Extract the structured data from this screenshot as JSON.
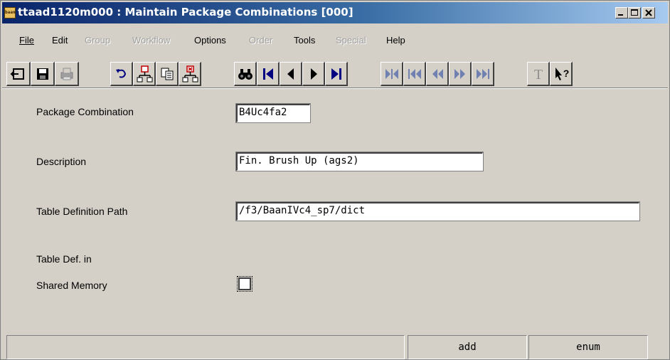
{
  "window": {
    "title": "ttaad1120m000 : Maintain Package Combinations [000]",
    "app_icon_text": "baan"
  },
  "menu": [
    {
      "label": "File",
      "enabled": true
    },
    {
      "label": "Edit",
      "enabled": true
    },
    {
      "label": "Group",
      "enabled": false
    },
    {
      "label": "Workflow",
      "enabled": false
    },
    {
      "label": "Options",
      "enabled": true
    },
    {
      "label": "Order",
      "enabled": false
    },
    {
      "label": "Tools",
      "enabled": true
    },
    {
      "label": "Special",
      "enabled": false
    },
    {
      "label": "Help",
      "enabled": true
    }
  ],
  "toolbar": {
    "icons": [
      "exit-icon",
      "save-icon",
      "print-icon",
      "undo-icon",
      "insert-record-icon",
      "copy-icon",
      "delete-record-icon",
      "find-icon",
      "first-record-icon",
      "previous-record-icon",
      "next-record-icon",
      "last-record-icon",
      "first-set-icon",
      "previous-set-icon",
      "previous-group-icon",
      "next-group-icon",
      "last-set-icon",
      "text-icon",
      "help-icon"
    ],
    "text_button_label": "T",
    "help_button_label": "?"
  },
  "form": {
    "package_combination": {
      "label": "Package Combination",
      "value": "B4Uc4fa2"
    },
    "description": {
      "label": "Description",
      "value": "Fin. Brush Up (ags2)"
    },
    "table_definition_path": {
      "label": "Table Definition Path",
      "value": "/f3/BaanIVc4_sp7/dict"
    },
    "shared_memory": {
      "label_line1": "Table Def. in",
      "label_line2": "Shared Memory",
      "checked": false
    }
  },
  "status": {
    "message": "",
    "mode": "add",
    "type": "enum"
  },
  "colors": {
    "face": "#d4d0c8",
    "title_start": "#0a246a",
    "title_end": "#a6caf0"
  }
}
